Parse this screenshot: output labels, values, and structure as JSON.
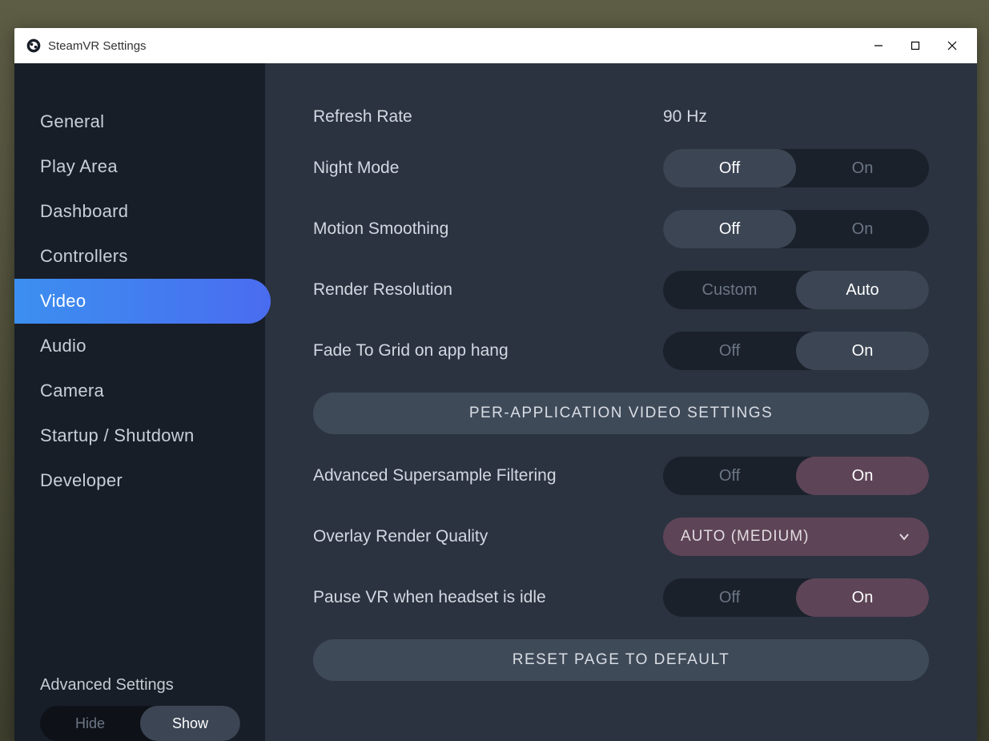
{
  "window": {
    "title": "SteamVR Settings",
    "minimize": "–",
    "maximize": "□",
    "close": "✕"
  },
  "sidebar": {
    "items": [
      {
        "label": "General"
      },
      {
        "label": "Play Area"
      },
      {
        "label": "Dashboard"
      },
      {
        "label": "Controllers"
      },
      {
        "label": "Video"
      },
      {
        "label": "Audio"
      },
      {
        "label": "Camera"
      },
      {
        "label": "Startup / Shutdown"
      },
      {
        "label": "Developer"
      }
    ],
    "active_index": 4,
    "advanced_label": "Advanced Settings",
    "advanced": {
      "hide": "Hide",
      "show": "Show",
      "value": "Show"
    }
  },
  "settings": {
    "refresh_rate": {
      "label": "Refresh Rate",
      "value": "90 Hz"
    },
    "night_mode": {
      "label": "Night Mode",
      "off": "Off",
      "on": "On",
      "value": "Off"
    },
    "motion_smoothing": {
      "label": "Motion Smoothing",
      "off": "Off",
      "on": "On",
      "value": "Off"
    },
    "render_resolution": {
      "label": "Render Resolution",
      "custom": "Custom",
      "auto": "Auto",
      "value": "Auto"
    },
    "fade_to_grid": {
      "label": "Fade To Grid on app hang",
      "off": "Off",
      "on": "On",
      "value": "On"
    },
    "per_app_button": "PER-APPLICATION VIDEO SETTINGS",
    "adv_supersample": {
      "label": "Advanced Supersample Filtering",
      "off": "Off",
      "on": "On",
      "value": "On"
    },
    "overlay_quality": {
      "label": "Overlay Render Quality",
      "value": "AUTO (MEDIUM)"
    },
    "pause_idle": {
      "label": "Pause VR when headset is idle",
      "off": "Off",
      "on": "On",
      "value": "On"
    },
    "reset_button": "RESET PAGE TO DEFAULT"
  }
}
